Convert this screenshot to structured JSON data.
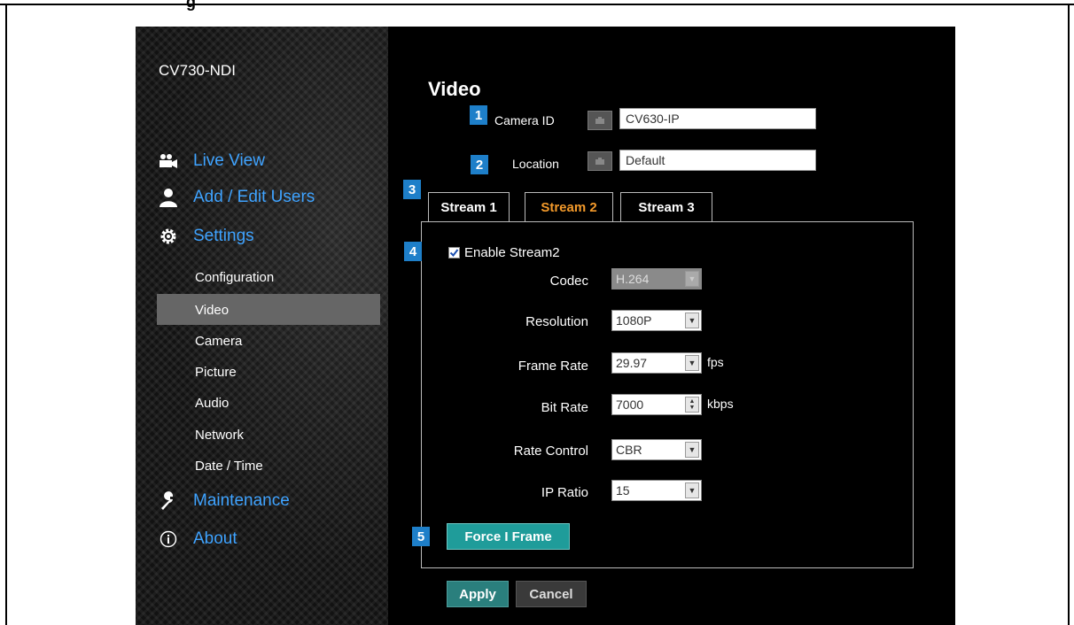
{
  "doc_heading_fragment": "g",
  "app": {
    "device_name": "CV730-NDI",
    "page_title": "Video"
  },
  "sidebar": {
    "main_items": [
      {
        "label": "Live View",
        "icon": "video-camera-icon"
      },
      {
        "label": "Add / Edit Users",
        "icon": "user-icon"
      },
      {
        "label": "Settings",
        "icon": "gear-icon"
      },
      {
        "label": "Maintenance",
        "icon": "wrench-icon"
      },
      {
        "label": "About",
        "icon": "info-icon"
      }
    ],
    "settings_items": [
      "Configuration",
      "Video",
      "Camera",
      "Picture",
      "Audio",
      "Network",
      "Date / Time"
    ],
    "active_item": "Video"
  },
  "badges": [
    "1",
    "2",
    "3",
    "4",
    "5"
  ],
  "fields": {
    "camera_id": {
      "label": "Camera ID",
      "value": "CV630-IP"
    },
    "location": {
      "label": "Location",
      "value": "Default"
    }
  },
  "tabs": [
    {
      "label": "Stream 1",
      "active": false
    },
    {
      "label": "Stream 2",
      "active": true
    },
    {
      "label": "Stream 3",
      "active": false
    }
  ],
  "stream": {
    "enable_label": "Enable Stream2",
    "enabled": true,
    "codec": {
      "label": "Codec",
      "value": "H.264"
    },
    "resolution": {
      "label": "Resolution",
      "value": "1080P"
    },
    "frame_rate": {
      "label": "Frame Rate",
      "value": "29.97",
      "unit": "fps"
    },
    "bit_rate": {
      "label": "Bit Rate",
      "value": "7000",
      "unit": "kbps"
    },
    "rate_control": {
      "label": "Rate Control",
      "value": "CBR"
    },
    "ip_ratio": {
      "label": "IP Ratio",
      "value": "15"
    },
    "force_iframe_label": "Force I Frame"
  },
  "buttons": {
    "apply": "Apply",
    "cancel": "Cancel"
  },
  "colors": {
    "nav_text": "#3fa3ff",
    "active_tab": "#f39a2b",
    "badge": "#1e7fc9",
    "teal_button": "#1f9c9a"
  }
}
